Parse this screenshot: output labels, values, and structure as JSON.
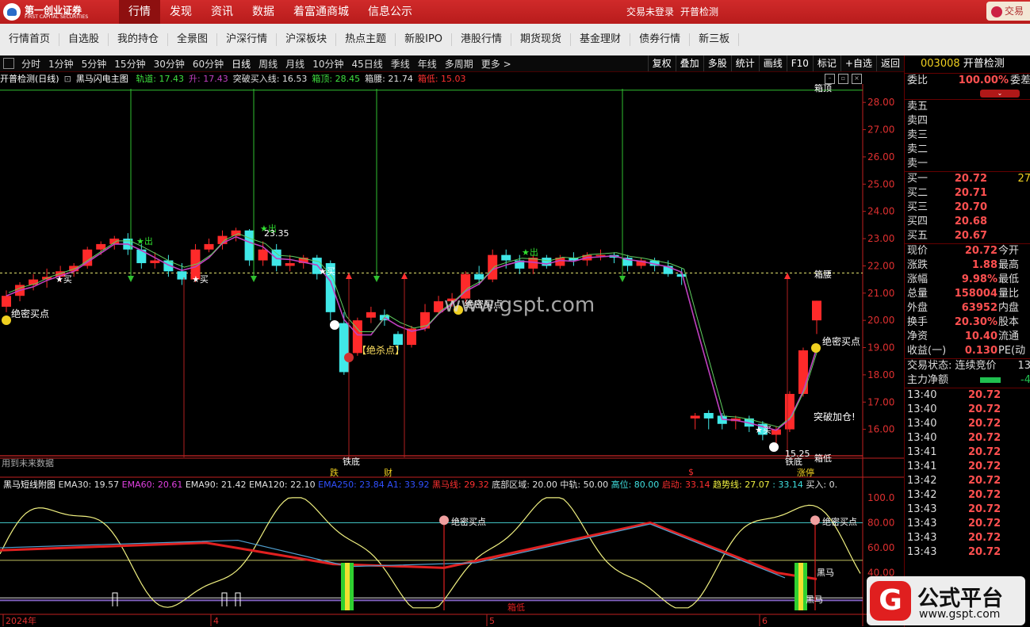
{
  "app": {
    "brand_cn": "第一创业证券",
    "brand_en": "FIRST CAPITAL SECURITIES",
    "top_nav": [
      "行情",
      "发现",
      "资讯",
      "数据",
      "着富通商城",
      "信息公示"
    ],
    "active_top": "行情",
    "trade_login": "交易未登录",
    "trade_stock": "开普检测",
    "user_tab": "交易"
  },
  "sub_nav": [
    "行情首页",
    "自选股",
    "我的持仓",
    "全景图",
    "沪深行情",
    "沪深板块",
    "热点主题",
    "新股IPO",
    "港股行情",
    "期货现货",
    "基金理财",
    "债券行情",
    "新三板"
  ],
  "periods": [
    "分时",
    "1分钟",
    "5分钟",
    "15分钟",
    "30分钟",
    "60分钟",
    "日线",
    "周线",
    "月线",
    "10分钟",
    "45日线",
    "季线",
    "年线",
    "多周期",
    "更多 >"
  ],
  "selected_period": "日线",
  "tools": [
    "复权",
    "叠加",
    "多股",
    "统计",
    "画线",
    "F10",
    "标记",
    "+自选",
    "返回"
  ],
  "main_info": {
    "title": "开普检测(日线)",
    "indicator": "黑马闪电主图",
    "items": [
      {
        "label": "轨道: 17.43",
        "color": "#40e040"
      },
      {
        "label": "升: 17.43",
        "color": "#c040c0"
      },
      {
        "label": "突破买入线: 16.53",
        "color": "#e0e0e0"
      },
      {
        "label": "箱顶: 28.45",
        "color": "#40e040"
      },
      {
        "label": "箱腰: 21.74",
        "color": "#e0e0e0"
      },
      {
        "label": "箱低: 15.03",
        "color": "#ff3030"
      }
    ]
  },
  "sub_info": {
    "title": "黑马短线附图",
    "items": [
      {
        "label": "EMA30: 19.57",
        "color": "#e0e0e0"
      },
      {
        "label": "EMA60: 20.61",
        "color": "#e040e0"
      },
      {
        "label": "EMA90: 21.42",
        "color": "#e0e0e0"
      },
      {
        "label": "EMA120: 22.10",
        "color": "#e0e0e0"
      },
      {
        "label": "EMA250: 23.84",
        "color": "#3050ff"
      },
      {
        "label": "A1: 33.92",
        "color": "#3050ff"
      },
      {
        "label": "黑马线: 29.32",
        "color": "#ff3030"
      },
      {
        "label": "底部区域: 20.00",
        "color": "#e0e0e0"
      },
      {
        "label": "中轨: 50.00",
        "color": "#e0e0e0"
      },
      {
        "label": "高位: 80.00",
        "color": "#40e0e0"
      },
      {
        "label": "启动: 33.14",
        "color": "#ff3030"
      },
      {
        "label": "趋势线: 27.07",
        "color": "#f0f040"
      },
      {
        "label": ": 33.14",
        "color": "#40e0e0"
      },
      {
        "label": "买入: 0.",
        "color": "#e0e0e0"
      }
    ]
  },
  "price_axis": [
    "28.00",
    "27.00",
    "26.00",
    "25.00",
    "24.00",
    "23.00",
    "22.00",
    "21.00",
    "20.00",
    "19.00",
    "18.00",
    "17.00",
    "16.00"
  ],
  "sub_axis": [
    "100.0",
    "80.00",
    "60.00",
    "40.00"
  ],
  "date_axis": [
    "2024年",
    "4",
    "5",
    "6"
  ],
  "annotations": {
    "jmmd": "绝密买点",
    "jsd": "【绝杀点】",
    "buy": "★买",
    "out": "★出",
    "price_high": "23.35",
    "price_low": "15.25",
    "box_top": "箱顶",
    "box_waist": "箱腰",
    "box_low": "箱低",
    "breakout": "突破加仓!",
    "future_data": "用到未来数据",
    "iron_bottom": "铁底",
    "fall": "跌",
    "cai": "财",
    "limit_up": "涨停",
    "s_mark": "$",
    "heima": "黑马",
    "xiangdi": "箱低"
  },
  "quote": {
    "code": "003008",
    "name": "开普检测",
    "weibi_label": "委比",
    "weibi": "100.00%",
    "weicha_label": "委差",
    "sell": [
      "卖五",
      "卖四",
      "卖三",
      "卖二",
      "卖一"
    ],
    "buy": [
      {
        "l": "买一",
        "p": "20.72",
        "n": "27"
      },
      {
        "l": "买二",
        "p": "20.71",
        "n": ""
      },
      {
        "l": "买三",
        "p": "20.70",
        "n": ""
      },
      {
        "l": "买四",
        "p": "20.68",
        "n": ""
      },
      {
        "l": "买五",
        "p": "20.67",
        "n": ""
      }
    ],
    "stats": [
      {
        "l": "现价",
        "v": "20.72",
        "r": "今开"
      },
      {
        "l": "涨跌",
        "v": "1.88",
        "r": "最高"
      },
      {
        "l": "涨幅",
        "v": "9.98%",
        "r": "最低"
      },
      {
        "l": "总量",
        "v": "158004",
        "r": "量比"
      },
      {
        "l": "外盘",
        "v": "63952",
        "r": "内盘"
      },
      {
        "l": "换手",
        "v": "20.30%",
        "r": "股本"
      },
      {
        "l": "净资",
        "v": "10.40",
        "r": "流通"
      },
      {
        "l": "收益(一)",
        "v": "0.130",
        "r": "PE(动"
      }
    ],
    "trade_state": "交易状态: 连续竞价",
    "trade_state_num": "13",
    "main_net": "主力净额",
    "main_net_val": "-4",
    "ticks": [
      {
        "t": "13:40",
        "p": "20.72"
      },
      {
        "t": "13:40",
        "p": "20.72"
      },
      {
        "t": "13:40",
        "p": "20.72"
      },
      {
        "t": "13:40",
        "p": "20.72"
      },
      {
        "t": "13:41",
        "p": "20.72"
      },
      {
        "t": "13:41",
        "p": "20.72"
      },
      {
        "t": "13:42",
        "p": "20.72"
      },
      {
        "t": "13:42",
        "p": "20.72"
      },
      {
        "t": "13:43",
        "p": "20.72"
      },
      {
        "t": "13:43",
        "p": "20.72"
      },
      {
        "t": "13:43",
        "p": "20.72"
      },
      {
        "t": "13:43",
        "p": "20.72"
      }
    ]
  },
  "watermark": "www.gspt.com",
  "badge": {
    "title": "公式平台",
    "url": "www.gspt.com",
    "glyph": "G"
  },
  "chart_data": {
    "type": "candlestick",
    "ylim": [
      15.0,
      28.5
    ],
    "box_top": 28.45,
    "box_waist": 21.74,
    "box_low": 15.03,
    "candles": [
      [
        20.5,
        20.9,
        21.1,
        20.3
      ],
      [
        20.9,
        21.3,
        21.4,
        20.7
      ],
      [
        21.3,
        21.5,
        21.7,
        21.1
      ],
      [
        21.5,
        21.6,
        21.9,
        21.2
      ],
      [
        21.6,
        21.8,
        22.0,
        21.4
      ],
      [
        21.8,
        22.0,
        22.1,
        21.6
      ],
      [
        22.0,
        22.6,
        22.7,
        21.9
      ],
      [
        22.6,
        22.8,
        22.9,
        22.4
      ],
      [
        22.8,
        23.0,
        23.1,
        22.6
      ],
      [
        23.0,
        22.6,
        23.2,
        22.4
      ],
      [
        22.6,
        22.1,
        22.8,
        21.9
      ],
      [
        22.1,
        22.2,
        22.5,
        21.9
      ],
      [
        22.2,
        21.8,
        22.4,
        21.6
      ],
      [
        21.8,
        21.5,
        22.1,
        21.3
      ],
      [
        21.5,
        22.6,
        22.8,
        21.4
      ],
      [
        22.6,
        22.8,
        23.0,
        22.5
      ],
      [
        22.8,
        23.1,
        23.3,
        22.6
      ],
      [
        23.1,
        23.3,
        23.4,
        22.9
      ],
      [
        23.3,
        22.2,
        23.35,
        22.0
      ],
      [
        22.2,
        22.6,
        22.9,
        22.0
      ],
      [
        22.6,
        22.0,
        22.8,
        21.8
      ],
      [
        22.0,
        22.1,
        22.4,
        21.8
      ],
      [
        22.1,
        22.3,
        22.4,
        21.9
      ],
      [
        22.3,
        21.7,
        22.4,
        21.5
      ],
      [
        22.1,
        20.3,
        22.2,
        20.0
      ],
      [
        19.9,
        18.1,
        20.3,
        18.0
      ],
      [
        18.8,
        20.0,
        20.1,
        18.7
      ],
      [
        20.1,
        20.3,
        20.5,
        19.9
      ],
      [
        20.2,
        20.0,
        20.4,
        19.8
      ],
      [
        19.5,
        19.1,
        19.6,
        18.9
      ],
      [
        19.1,
        19.7,
        19.8,
        19.0
      ],
      [
        19.7,
        20.3,
        20.6,
        19.6
      ],
      [
        20.3,
        20.7,
        20.9,
        20.2
      ],
      [
        20.7,
        20.8,
        21.0,
        20.5
      ],
      [
        20.8,
        21.7,
        21.8,
        20.6
      ],
      [
        21.7,
        21.5,
        22.0,
        21.3
      ],
      [
        21.5,
        22.4,
        22.6,
        21.4
      ],
      [
        22.4,
        22.2,
        22.6,
        21.9
      ],
      [
        22.2,
        21.9,
        22.4,
        21.7
      ],
      [
        21.9,
        22.3,
        22.4,
        21.7
      ],
      [
        22.3,
        22.0,
        22.4,
        21.9
      ],
      [
        22.0,
        22.3,
        22.4,
        21.9
      ],
      [
        22.3,
        22.2,
        22.5,
        22.0
      ],
      [
        22.2,
        22.4,
        22.5,
        22.0
      ],
      [
        22.4,
        22.4,
        22.6,
        22.2
      ],
      [
        22.4,
        22.3,
        22.5,
        22.1
      ],
      [
        22.3,
        22.0,
        22.4,
        21.8
      ],
      [
        22.0,
        22.2,
        22.3,
        21.9
      ],
      [
        22.2,
        22.0,
        22.3,
        21.8
      ],
      [
        22.0,
        21.7,
        22.2,
        21.6
      ],
      [
        21.7,
        21.6,
        21.9,
        21.3
      ],
      [
        16.4,
        16.5,
        16.6,
        16.0
      ],
      [
        16.6,
        16.4,
        16.7,
        16.0
      ],
      [
        16.5,
        16.2,
        16.6,
        16.0
      ],
      [
        16.3,
        16.4,
        16.5,
        16.0
      ],
      [
        16.4,
        16.1,
        16.5,
        15.9
      ],
      [
        16.2,
        15.8,
        16.3,
        15.6
      ],
      [
        15.8,
        16.0,
        16.1,
        15.25
      ],
      [
        16.0,
        17.3,
        17.4,
        15.9
      ],
      [
        17.3,
        18.9,
        19.0,
        17.2
      ],
      [
        20.0,
        20.72,
        20.72,
        19.5
      ]
    ]
  }
}
